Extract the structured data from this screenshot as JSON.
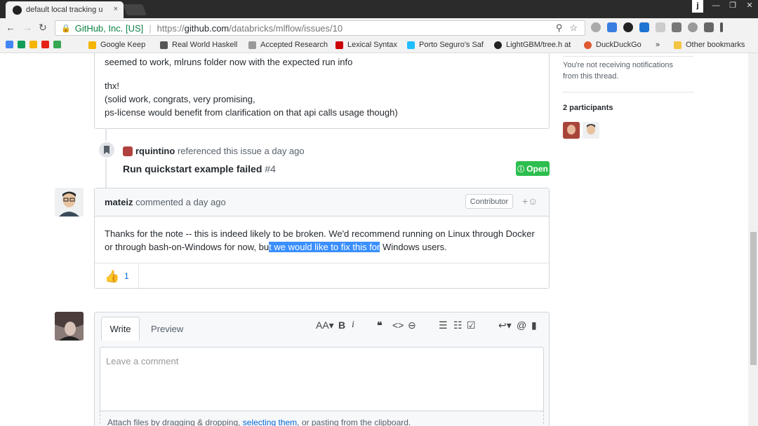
{
  "browser": {
    "tab_title": "default local tracking u",
    "tab_close": "×",
    "user_badge": "j",
    "window_controls": [
      "—",
      "❐",
      "✕"
    ],
    "secure_label": "GitHub, Inc. [US]",
    "url_prefix": "https://",
    "url_host": "github.com",
    "url_path": "/databricks/mlflow/issues/10",
    "bookmarks": [
      {
        "label": "Google Keep",
        "color": "#f4b400"
      },
      {
        "label": "Real World Haskell",
        "color": "#555555"
      },
      {
        "label": "Accepted Research",
        "color": "#777777"
      },
      {
        "label": "Lexical Syntax",
        "color": "#cc0000"
      },
      {
        "label": "Porto Seguro's Saf",
        "color": "#20beff"
      },
      {
        "label": "LightGBM/tree.h at",
        "color": "#222222"
      },
      {
        "label": "DuckDuckGo",
        "color": "#de5833"
      },
      {
        "label": "»",
        "color": ""
      },
      {
        "label": "Other bookmarks",
        "color": "#f4c542"
      }
    ]
  },
  "thread": {
    "prev_comment_lines": [
      "seemed to work, mlruns folder now with the expected run info",
      "thx!",
      "(solid work, congrats, very promising,",
      "ps-license would benefit from clarification on that api calls usage though)"
    ],
    "reference": {
      "user": "rquintino",
      "text": "referenced this issue a day ago",
      "issue_title": "Run quickstart example failed",
      "issue_number": "#4",
      "status": "Open"
    },
    "comment": {
      "author": "mateiz",
      "meta": "commented a day ago",
      "role": "Contributor",
      "line1": "Thanks for the note -- this is indeed likely to be broken. We'd recommend running on Linux through Docker",
      "line2_pre": "or through bash-on-Windows for now, bu",
      "line2_sel": "t we would like to fix this for",
      "line2_post": " Windows users.",
      "reaction_count": "1"
    },
    "composer": {
      "tab_write": "Write",
      "tab_preview": "Preview",
      "placeholder": "Leave a comment",
      "attach_pre": "Attach files by dragging & dropping, ",
      "attach_link": "selecting them",
      "attach_post": ", or pasting from the clipboard."
    }
  },
  "sidebar": {
    "notify_line1": "You're not receiving notifications",
    "notify_line2": "from this thread.",
    "participants_title": "2 participants"
  }
}
